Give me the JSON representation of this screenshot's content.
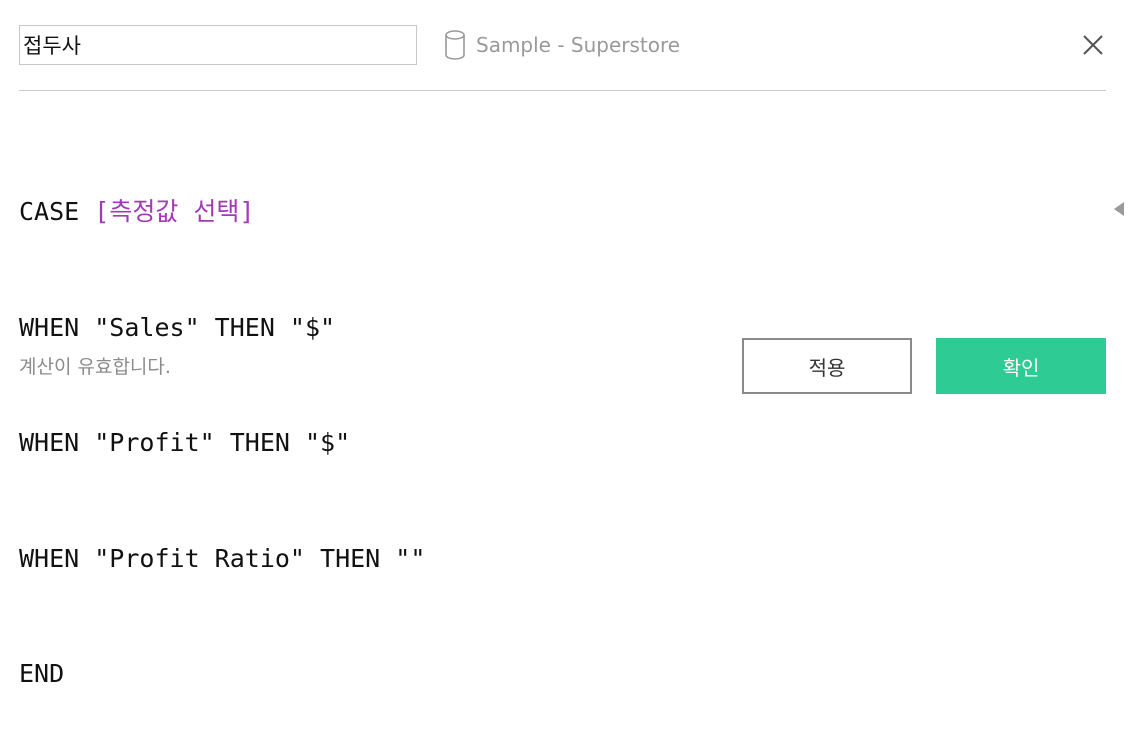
{
  "header": {
    "calc_name": "접두사",
    "datasource": "Sample - Superstore",
    "datasource_icon": "database-icon",
    "close_icon": "close-icon"
  },
  "editor": {
    "lines": [
      [
        {
          "text": "CASE ",
          "kind": "keyword"
        },
        {
          "text": "[측정값 선택]",
          "kind": "field"
        }
      ],
      [
        {
          "text": "WHEN \"Sales\" THEN \"$\"",
          "kind": "keyword"
        }
      ],
      [
        {
          "text": "WHEN \"Profit\" THEN \"$\"",
          "kind": "keyword"
        }
      ],
      [
        {
          "text": "WHEN \"Profit Ratio\" THEN \"\"",
          "kind": "keyword"
        }
      ],
      [
        {
          "text": "END",
          "kind": "keyword"
        }
      ]
    ],
    "field_color": "#a23ab5",
    "text_color": "#111111"
  },
  "footer": {
    "status": "계산이 유효합니다.",
    "apply_label": "적용",
    "ok_label": "확인",
    "ok_color": "#2fcb95"
  },
  "side_panel_icon": "collapse-left-arrow-icon"
}
